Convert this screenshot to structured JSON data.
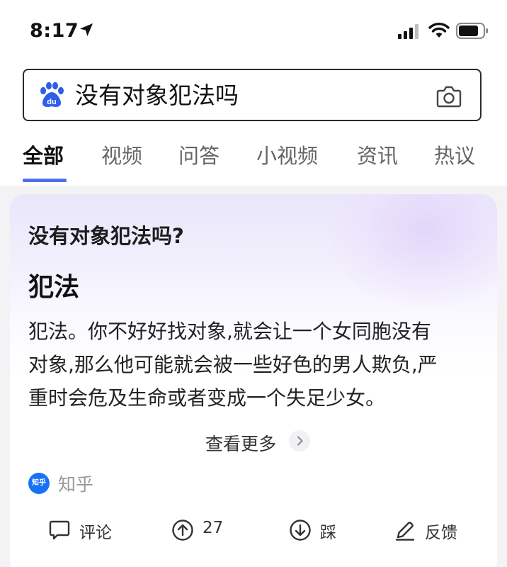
{
  "status_bar": {
    "time": "8:17",
    "icons": [
      "location-arrow-icon",
      "signal-icon",
      "wifi-icon",
      "battery-icon"
    ]
  },
  "search": {
    "query": "没有对象犯法吗",
    "logo_icon": "baidu-paw-icon",
    "camera_icon": "camera-icon"
  },
  "tabs": [
    {
      "label": "全部",
      "active": true
    },
    {
      "label": "视频",
      "active": false
    },
    {
      "label": "问答",
      "active": false
    },
    {
      "label": "小视频",
      "active": false
    },
    {
      "label": "资讯",
      "active": false
    },
    {
      "label": "热议",
      "active": false
    }
  ],
  "card": {
    "question": "没有对象犯法吗?",
    "answer_heading": "犯法",
    "body_lines": [
      "犯法。你不好好找对象,就会让一个女同胞没有",
      "对象,那么他可能就会被一些好色的男人欺负,严",
      "重时会危及生命或者变成一个失足少女。"
    ],
    "see_more": "查看更多",
    "source": {
      "logo_text": "知乎",
      "name": "知乎"
    },
    "actions": {
      "comment": "评论",
      "upvote_count": "27",
      "downvote": "踩",
      "feedback": "反馈"
    }
  },
  "colors": {
    "accent": "#4e6ef2",
    "zhihu_blue": "#1772f6",
    "card_tint": "#eae6fb"
  }
}
